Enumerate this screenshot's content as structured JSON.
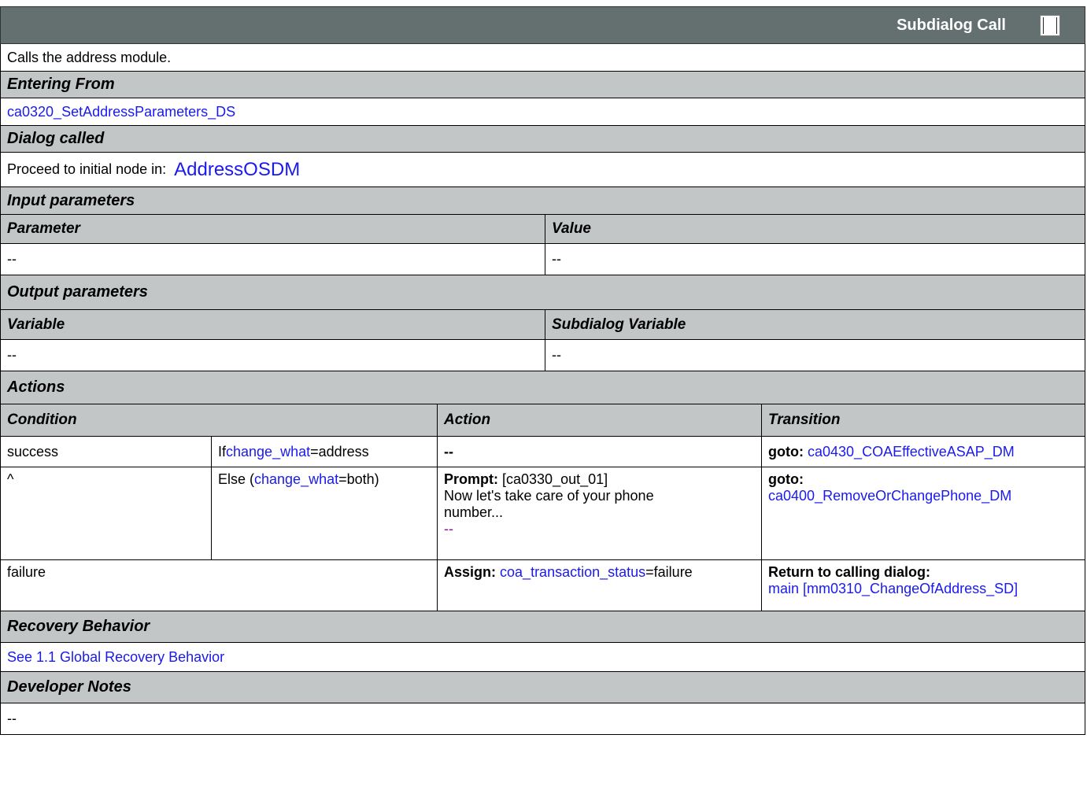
{
  "header": {
    "title": "Subdialog Call"
  },
  "description": "Calls the address module.",
  "entering_from": {
    "label": "Entering From",
    "link": "ca0320_SetAddressParameters_DS"
  },
  "dialog_called": {
    "label": "Dialog called",
    "text": "Proceed to initial node in:",
    "link": "AddressOSDM"
  },
  "input_parameters": {
    "label": "Input parameters",
    "columns": [
      "Parameter",
      "Value"
    ],
    "row": [
      "--",
      "--"
    ]
  },
  "output_parameters": {
    "label": "Output parameters",
    "columns": [
      "Variable",
      "Subdialog Variable"
    ],
    "row": [
      "--",
      "--"
    ]
  },
  "actions": {
    "label": "Actions",
    "columns": [
      "Condition",
      "Action",
      "Transition"
    ],
    "rows": [
      {
        "condition": "success",
        "sub_prefix": "If ",
        "sub_link": "change_what",
        "sub_suffix": "=address",
        "action_text": "--",
        "trans_label": "goto:",
        "trans_link": "ca0430_COAEffectiveASAP_DM"
      },
      {
        "condition": "^",
        "sub_prefix": "Else (",
        "sub_link": "change_what",
        "sub_suffix": "=both)",
        "action_label": "Prompt:",
        "action_id": "[ca0330_out_01]",
        "action_text": "Now let's take care of your phone number...",
        "action_link": "--",
        "trans_label": "goto:",
        "trans_link": "ca0400_RemoveOrChangePhone_DM"
      },
      {
        "condition": "failure",
        "action_label": "Assign:",
        "action_link": "coa_transaction_status",
        "action_suffix": " =failure",
        "trans_label": "Return to calling dialog:",
        "trans_link": "main [mm0310_ChangeOfAddress_SD]"
      }
    ]
  },
  "recovery": {
    "label": "Recovery Behavior",
    "link": "See 1.1 Global Recovery Behavior"
  },
  "developer_notes": {
    "label": "Developer Notes",
    "text": "--"
  }
}
